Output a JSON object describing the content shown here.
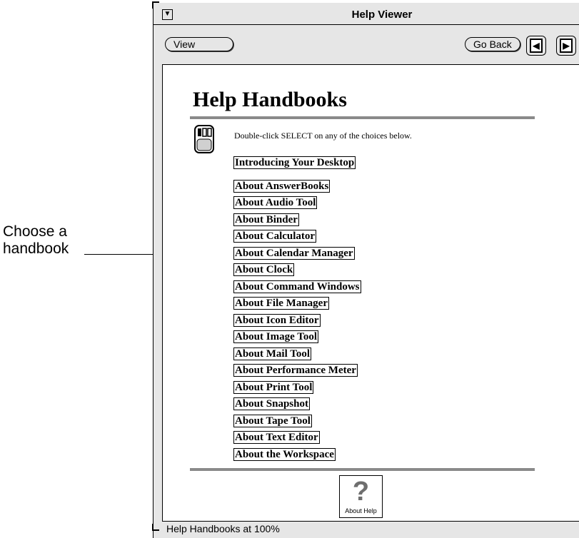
{
  "callout": {
    "text": "Choose a handbook"
  },
  "window": {
    "title": "Help Viewer",
    "menu_glyph": "▼"
  },
  "toolbar": {
    "view_label": "View",
    "goback_label": "Go Back",
    "prev_glyph": "◀",
    "next_glyph": "▶"
  },
  "page": {
    "heading": "Help Handbooks",
    "instruction": "Double-click SELECT on any of the choices below.",
    "links": [
      "Introducing Your Desktop",
      "About AnswerBooks",
      "About Audio Tool",
      "About Binder",
      "About Calculator",
      "About Calendar Manager",
      "About Clock",
      "About Command Windows",
      "About File Manager",
      "About Icon Editor",
      "About Image Tool",
      "About Mail Tool",
      "About Performance Meter",
      "About Print Tool",
      "About Snapshot",
      "About Tape Tool",
      "About Text Editor",
      "About the Workspace"
    ],
    "about_help": {
      "glyph": "?",
      "label": "About Help"
    }
  },
  "status": {
    "text": "Help Handbooks at 100%"
  }
}
